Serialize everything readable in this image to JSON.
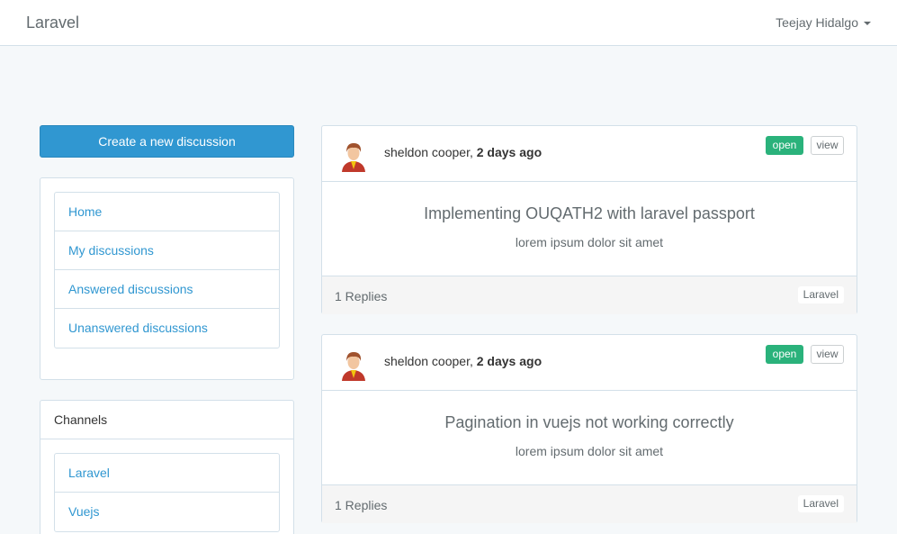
{
  "navbar": {
    "brand": "Laravel",
    "user_name": "Teejay Hidalgo"
  },
  "sidebar": {
    "create_button": "Create a new discussion",
    "nav_items": [
      {
        "label": "Home"
      },
      {
        "label": "My discussions"
      },
      {
        "label": "Answered discussions"
      },
      {
        "label": "Unanswered discussions"
      }
    ],
    "channels_heading": "Channels",
    "channels": [
      {
        "label": "Laravel"
      },
      {
        "label": "Vuejs"
      }
    ]
  },
  "discussions": [
    {
      "author": "sheldon cooper,",
      "time": "2 days ago",
      "status": "open",
      "view_label": "view",
      "title": "Implementing OUQATH2 with laravel passport",
      "body": "lorem ipsum dolor sit amet",
      "replies": "1 Replies",
      "channel": "Laravel"
    },
    {
      "author": "sheldon cooper,",
      "time": "2 days ago",
      "status": "open",
      "view_label": "view",
      "title": "Pagination in vuejs not working correctly",
      "body": "lorem ipsum dolor sit amet",
      "replies": "1 Replies",
      "channel": "Laravel"
    }
  ],
  "colors": {
    "primary": "#3097d1",
    "success": "#2ab27b",
    "background": "#f5f8fa"
  },
  "icons": [
    "user-avatar-icon",
    "caret-down-icon"
  ]
}
